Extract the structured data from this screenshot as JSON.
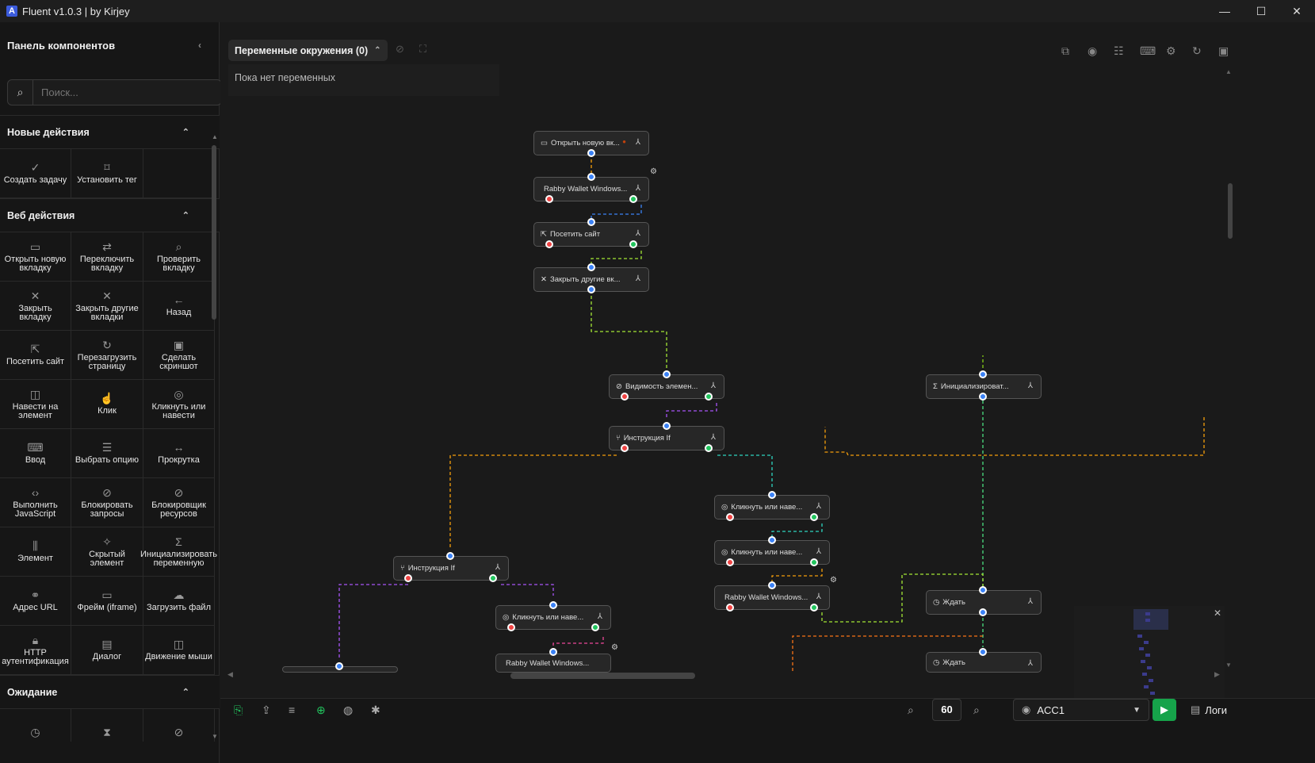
{
  "window": {
    "title": "Fluent v1.0.3 | by Kirjey",
    "logo": "A"
  },
  "sidebar": {
    "title": "Панель компонентов",
    "search_placeholder": "Поиск...",
    "categories": [
      {
        "title": "Новые действия",
        "items": [
          {
            "label": "Создать задачу",
            "icon": "task-add-icon"
          },
          {
            "label": "Установить тег",
            "icon": "tag-icon"
          }
        ]
      },
      {
        "title": "Веб действия",
        "items": [
          {
            "label": "Открыть новую вкладку",
            "icon": "new-tab-icon"
          },
          {
            "label": "Переключить вкладку",
            "icon": "switch-tab-icon"
          },
          {
            "label": "Проверить вкладку",
            "icon": "check-tab-icon"
          },
          {
            "label": "Закрыть вкладку",
            "icon": "close-tab-icon"
          },
          {
            "label": "Закрыть другие вкладки",
            "icon": "close-others-icon"
          },
          {
            "label": "Назад",
            "icon": "back-icon"
          },
          {
            "label": "Посетить сайт",
            "icon": "visit-site-icon"
          },
          {
            "label": "Перезагрузить страницу",
            "icon": "reload-icon"
          },
          {
            "label": "Сделать скриншот",
            "icon": "screenshot-icon"
          },
          {
            "label": "Навести на элемент",
            "icon": "mouse-icon"
          },
          {
            "label": "Клик",
            "icon": "click-icon"
          },
          {
            "label": "Кликнуть или навести",
            "icon": "click-hover-icon"
          },
          {
            "label": "Ввод",
            "icon": "keyboard-icon"
          },
          {
            "label": "Выбрать опцию",
            "icon": "select-icon"
          },
          {
            "label": "Прокрутка",
            "icon": "scroll-icon"
          },
          {
            "label": "Выполнить JavaScript",
            "icon": "code-icon"
          },
          {
            "label": "Блокировать запросы",
            "icon": "block-icon"
          },
          {
            "label": "Блокировщик ресурсов",
            "icon": "block-resources-icon"
          },
          {
            "label": "Элемент",
            "icon": "element-icon"
          },
          {
            "label": "Скрытый элемент",
            "icon": "hidden-element-icon"
          },
          {
            "label": "Инициализировать переменную",
            "icon": "sigma-icon"
          },
          {
            "label": "Адрес URL",
            "icon": "link-icon"
          },
          {
            "label": "Фрейм (iframe)",
            "icon": "frame-icon"
          },
          {
            "label": "Загрузить файл",
            "icon": "upload-icon"
          },
          {
            "label": "HTTP аутентификация",
            "icon": "lock-icon"
          },
          {
            "label": "Диалог",
            "icon": "dialog-icon"
          },
          {
            "label": "Движение мыши",
            "icon": "mouse-move-icon"
          }
        ]
      },
      {
        "title": "Ожидание",
        "items": [
          {
            "label": "",
            "icon": "clock-icon"
          },
          {
            "label": "",
            "icon": "hourglass-icon"
          },
          {
            "label": "",
            "icon": "eye-off-icon"
          }
        ]
      }
    ]
  },
  "env": {
    "label": "Переменные окружения (0)",
    "empty_text": "Пока нет переменных"
  },
  "nodes": [
    {
      "label": "Открыть новую вк...",
      "icon": "new-tab-icon"
    },
    {
      "label": "Rabby Wallet Windows...",
      "icon": ""
    },
    {
      "label": "Посетить сайт",
      "icon": "visit-site-icon"
    },
    {
      "label": "Закрыть другие вк...",
      "icon": "close-icon"
    },
    {
      "label": "Видимость элемен...",
      "icon": "eye-off-icon"
    },
    {
      "label": "Инструкция If",
      "icon": "branch-icon"
    },
    {
      "label": "Инициализироват...",
      "icon": "sigma-icon"
    },
    {
      "label": "Кликнуть или наве...",
      "icon": "click-hover-icon"
    },
    {
      "label": "Кликнуть или наве...",
      "icon": "click-hover-icon"
    },
    {
      "label": "Rabby Wallet Windows...",
      "icon": ""
    },
    {
      "label": "Ждать",
      "icon": "clock-icon"
    },
    {
      "label": "Инструкция If",
      "icon": "branch-icon"
    },
    {
      "label": "Кликнуть или наве...",
      "icon": "click-hover-icon"
    },
    {
      "label": "Ждать",
      "icon": "clock-icon"
    },
    {
      "label": "Rabby Wallet Windows...",
      "icon": ""
    }
  ],
  "bottombar": {
    "zoom": "60",
    "account": "ACC1",
    "logs_label": "Логи"
  },
  "colors": {
    "accent_green": "#16a34a",
    "port_blue": "#3b82f6",
    "port_red": "#ef4444",
    "port_green": "#22c55e"
  }
}
